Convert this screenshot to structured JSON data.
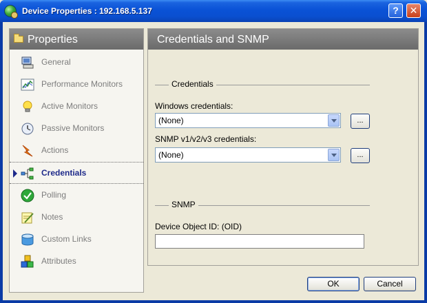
{
  "window": {
    "title": "Device Properties : 192.168.5.137"
  },
  "titlebar": {
    "help_label": "?",
    "close_label": "✕"
  },
  "left_panel": {
    "title": "Properties",
    "items": [
      {
        "label": "General",
        "icon": "computer-icon"
      },
      {
        "label": "Performance Monitors",
        "icon": "chart-icon"
      },
      {
        "label": "Active Monitors",
        "icon": "lightbulb-icon"
      },
      {
        "label": "Passive Monitors",
        "icon": "clock-icon"
      },
      {
        "label": "Actions",
        "icon": "lightning-icon"
      },
      {
        "label": "Credentials",
        "icon": "network-icon",
        "active": true
      },
      {
        "label": "Polling",
        "icon": "checkmark-icon"
      },
      {
        "label": "Notes",
        "icon": "notepad-icon"
      },
      {
        "label": "Custom Links",
        "icon": "database-icon"
      },
      {
        "label": "Attributes",
        "icon": "blocks-icon"
      }
    ]
  },
  "right_panel": {
    "title": "Credentials and SNMP",
    "credentials_group": "Credentials",
    "windows_label": "Windows credentials:",
    "windows_value": "(None)",
    "snmp_label": "SNMP v1/v2/v3 credentials:",
    "snmp_value": "(None)",
    "browse_label": "...",
    "snmp_group": "SNMP",
    "oid_label": "Device Object ID: (OID)",
    "oid_value": ""
  },
  "buttons": {
    "ok": "OK",
    "cancel": "Cancel"
  },
  "colors": {
    "title_bar": "#0a52d6",
    "accent_nav": "#1e2a8a",
    "panel_header": "#7a7a7a",
    "face": "#ece9d8"
  }
}
